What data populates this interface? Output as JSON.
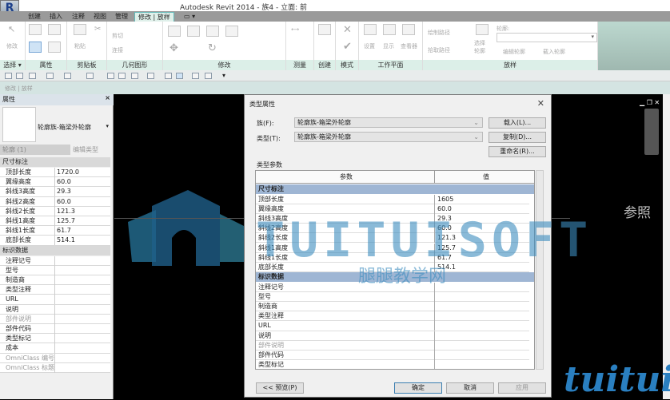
{
  "app": {
    "title": "Autodesk Revit 2014 -     族4 - 立面: 前",
    "app_button": "R"
  },
  "tabs": [
    "创建",
    "插入",
    "注释",
    "视图",
    "管理",
    "修改 | 放样"
  ],
  "ribbon": {
    "panels": [
      "选择 ▾",
      "属性",
      "剪贴板",
      "几何图形",
      "修改",
      "测量",
      "创建",
      "模式",
      "工作平面",
      "放样"
    ],
    "modify": "修改",
    "paste": "粘贴",
    "cut": "剪切",
    "join": "连接",
    "set": "设置",
    "show": "显示",
    "viewer": "查看器",
    "sketch_path": "绘制路径",
    "pick_path": "拾取路径",
    "select_profile": "选择轮廓",
    "profile_label": "轮廓:",
    "edit_profile": "编辑轮廓",
    "load_profile": "载入轮廓"
  },
  "options_bar": "修改 | 放样",
  "properties": {
    "title": "属性",
    "type_name": "轮廓族-箱梁外轮廓",
    "instance_selector": "轮廓 (1)",
    "edit_type": "编辑类型",
    "groups": [
      {
        "name": "尺寸标注",
        "rows": [
          [
            "顶部长度",
            "1720.0"
          ],
          [
            "翼缘高度",
            "60.0"
          ],
          [
            "斜线3高度",
            "29.3"
          ],
          [
            "斜线2高度",
            "60.0"
          ],
          [
            "斜线2长度",
            "121.3"
          ],
          [
            "斜线1高度",
            "125.7"
          ],
          [
            "斜线1长度",
            "61.7"
          ],
          [
            "底部长度",
            "514.1"
          ]
        ]
      },
      {
        "name": "标识数据",
        "rows": [
          [
            "注释记号",
            ""
          ],
          [
            "型号",
            ""
          ],
          [
            "制造商",
            ""
          ],
          [
            "类型注释",
            ""
          ],
          [
            "URL",
            ""
          ],
          [
            "说明",
            ""
          ],
          [
            "部件说明",
            ""
          ],
          [
            "部件代码",
            ""
          ],
          [
            "类型标记",
            ""
          ],
          [
            "成本",
            ""
          ],
          [
            "OmniClass 编号",
            ""
          ],
          [
            "OmniClass 标题",
            ""
          ]
        ]
      }
    ]
  },
  "canvas": {
    "reference_label": "参照"
  },
  "watermark": {
    "brand": "TUITUISOFT",
    "cn": "腿腿教学网",
    "small": "tuituis"
  },
  "dialog": {
    "title": "类型属性",
    "family_label": "族(F):",
    "family_value": "轮廓族-箱梁外轮廓",
    "type_label": "类型(T):",
    "type_value": "轮廓族-箱梁外轮廓",
    "load": "载入(L)...",
    "duplicate": "复制(D)...",
    "rename": "重命名(R)...",
    "section": "类型参数",
    "col_param": "参数",
    "col_value": "值",
    "groups": [
      {
        "name": "尺寸标注",
        "rows": [
          [
            "顶部长度",
            "1605"
          ],
          [
            "翼缘高度",
            "60.0"
          ],
          [
            "斜线3高度",
            "29.3"
          ],
          [
            "斜线2高度",
            "60.0"
          ],
          [
            "斜线2长度",
            "121.3"
          ],
          [
            "斜线1高度",
            "125.7"
          ],
          [
            "斜线1长度",
            "61.7"
          ],
          [
            "底部长度",
            "514.1"
          ]
        ]
      },
      {
        "name": "标识数据",
        "rows": [
          [
            "注释记号",
            ""
          ],
          [
            "型号",
            ""
          ],
          [
            "制造商",
            ""
          ],
          [
            "类型注释",
            ""
          ],
          [
            "URL",
            ""
          ],
          [
            "说明",
            ""
          ],
          [
            "部件说明",
            ""
          ],
          [
            "部件代码",
            ""
          ],
          [
            "类型标记",
            ""
          ]
        ]
      }
    ],
    "preview": "<< 预览(P)",
    "ok": "确定",
    "cancel": "取消",
    "apply": "应用"
  }
}
